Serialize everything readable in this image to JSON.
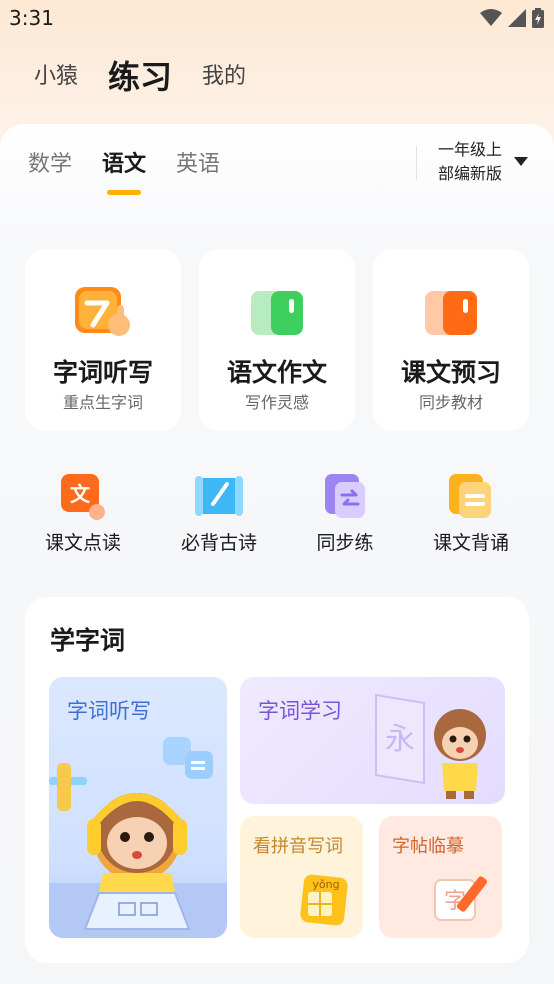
{
  "status_bar": {
    "time": "3:31"
  },
  "top_nav": {
    "items": [
      "小猿",
      "练习",
      "我的"
    ],
    "active_index": 1
  },
  "subject_tabs": {
    "items": [
      "数学",
      "语文",
      "英语"
    ],
    "active_index": 1
  },
  "grade_selector": {
    "line1": "一年级上",
    "line2": "部编新版"
  },
  "feature_cards": [
    {
      "title": "字词听写",
      "subtitle": "重点生字词"
    },
    {
      "title": "语文作文",
      "subtitle": "写作灵感"
    },
    {
      "title": "课文预习",
      "subtitle": "同步教材"
    }
  ],
  "quick_items": [
    {
      "label": "课文点读",
      "icon_text": "文"
    },
    {
      "label": "必背古诗"
    },
    {
      "label": "同步练"
    },
    {
      "label": "课文背诵"
    }
  ],
  "learn_words": {
    "title": "学字词",
    "tiles": {
      "dictation": "字词听写",
      "study": "字词学习",
      "pinyin": "看拼音写词",
      "copy": "字帖临摹"
    },
    "study_char": "永",
    "pinyin_badge": "yǒng",
    "copy_char": "字"
  },
  "colors": {
    "accent": "#ffb000",
    "brand_orange": "#ff7a1a"
  }
}
